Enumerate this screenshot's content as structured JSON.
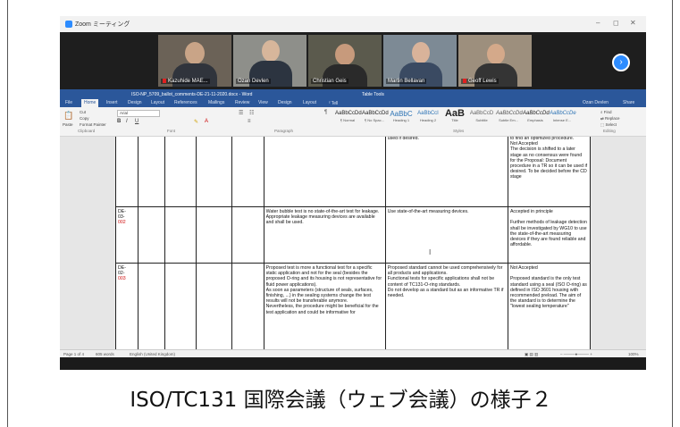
{
  "zoom": {
    "title": "Zoom ミーティング",
    "window_controls": [
      "–",
      "◻",
      "✕"
    ],
    "participants": [
      {
        "name": "Kazuhide MAE..."
      },
      {
        "name": "Ozan Devlen"
      },
      {
        "name": "Christian Geis"
      },
      {
        "name": "Martin Bellavan"
      },
      {
        "name": "Geoff Lewis"
      }
    ],
    "next_label": "›"
  },
  "word": {
    "title": "ISO-NP_5709_ballot_comments-DE-21-11-2020.docx - Word",
    "tools_label": "Table Tools",
    "tell_me": "Tell me what you want to do",
    "user": "Ozan Devlen",
    "share": "Share",
    "tabs": [
      "File",
      "Home",
      "Insert",
      "Design",
      "Layout",
      "References",
      "Mailings",
      "Review",
      "View",
      "Design",
      "Layout"
    ],
    "ribbon": {
      "clipboard": {
        "cut": "Cut",
        "copy": "Copy",
        "paste": "Paste",
        "painter": "Format Painter"
      },
      "font_name": "Arial",
      "groups": [
        "Clipboard",
        "Font",
        "Paragraph",
        "Styles",
        "Editing"
      ],
      "styles": [
        {
          "sample": "AaBbCcDd",
          "label": "¶ Normal"
        },
        {
          "sample": "AaBbCcDd",
          "label": "¶ No Spac..."
        },
        {
          "sample": "AaBbC",
          "label": "Heading 1"
        },
        {
          "sample": "AaBbCcI",
          "label": "Heading 2"
        },
        {
          "sample": "AaB",
          "label": "Title"
        },
        {
          "sample": "AaBbCcD",
          "label": "Subtitle"
        },
        {
          "sample": "AaBbCcDd",
          "label": "Subtle Em..."
        },
        {
          "sample": "AaBbCcDd",
          "label": "Emphasis"
        },
        {
          "sample": "AaBbCcDe",
          "label": "Intense E..."
        }
      ],
      "editing": {
        "find": "Find",
        "replace": "Replace",
        "select": "Select"
      }
    },
    "rows": [
      {
        "code": "",
        "code_num": "",
        "comment": "",
        "proposed": "used if desired.",
        "decision": "to find an optimized procedure.\nNot Accepted\nThe decision is shifted to a later stage as no consensus were found for the Proposal: Document procedure in a TR so it can be used if desired. To be decided before the CD stage"
      },
      {
        "code": "DE-\n03-",
        "code_num": "002",
        "comment": "Water bubble test is no state-of-the-art test for leakage. Appropriate leakage measuring devices are available and shall be used.",
        "proposed": "Use state-of-the-art measuring devices.",
        "decision": "Accepted in principle\n\nFurther methods of leakage detection shall be investigated by WG10 to use the state-of-the-art measuring devices if they are found reliable and affordable."
      },
      {
        "code": "DE-\n02-",
        "code_num": "003",
        "comment": "Proposed test is more a functional test for a specific static application and not for the seal (besides the proposed O-ring and its housing is not representative for fluid power applications).\nAs soon as parameters (structure of seals, surfaces, finishing, ...) in the sealing systems change the test results will not be transferable anymore.\nNevertheless, the procedure might be beneficial for the test application and could be informative for",
        "proposed": "Proposed standard cannot be used comprehensively for all products and applications.\nFunctional tests for specific applications shall not be content of TC131-O-ring standards.\nDo not develop as a standard but as an informative TR if needed.",
        "decision": "Not Accepted\n\nProposed standard is the only test standard using a seal (ISO O-ring) as defined in ISO 3601 housing with recommended preload. The aim of the standard is to determine the \"lowest sealing temperature\""
      }
    ],
    "status": {
      "page": "Page 1 of 4",
      "words": "605 words",
      "language": "English (United Kingdom)",
      "zoom": "100%"
    }
  },
  "caption": "ISO/TC131 国際会議（ウェブ会議）の様子２"
}
